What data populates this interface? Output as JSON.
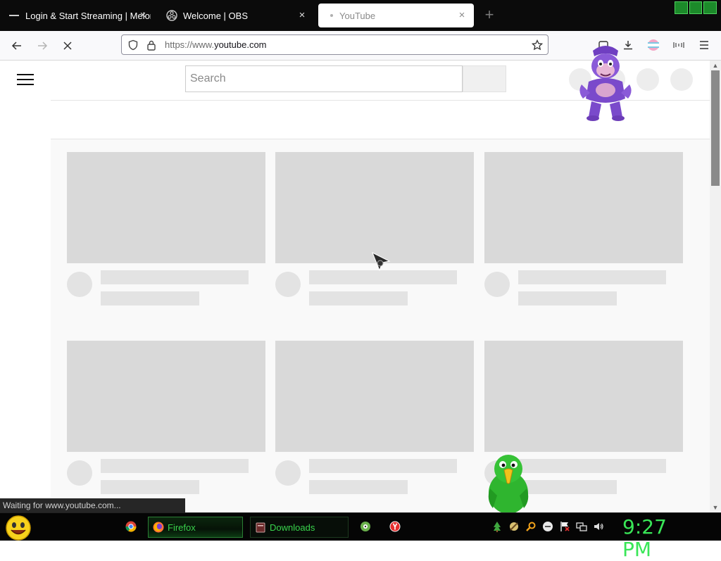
{
  "browser": {
    "tabs": [
      {
        "title": "Login & Start Streaming | Melon",
        "active": false
      },
      {
        "title": "Welcome | OBS",
        "active": false
      },
      {
        "title": "YouTube",
        "active": true
      }
    ],
    "new_tab_symbol": "+",
    "close_symbol": "×",
    "url_prefix": "https://www.",
    "url_domain": "youtube.com",
    "status": "Waiting for www.youtube.com..."
  },
  "youtube": {
    "search_placeholder": "Search",
    "skeleton_rows": 2,
    "skeleton_cols": 3
  },
  "taskbar": {
    "tasks": [
      {
        "label": "Firefox",
        "icon": "firefox-icon"
      },
      {
        "label": "Downloads",
        "icon": "folder-icon"
      }
    ],
    "clock": "9:27 PM"
  },
  "colors": {
    "taskbar_green": "#39d44c",
    "tab_strip": "#0b0b0b",
    "skeleton": "#d9d9d9"
  }
}
